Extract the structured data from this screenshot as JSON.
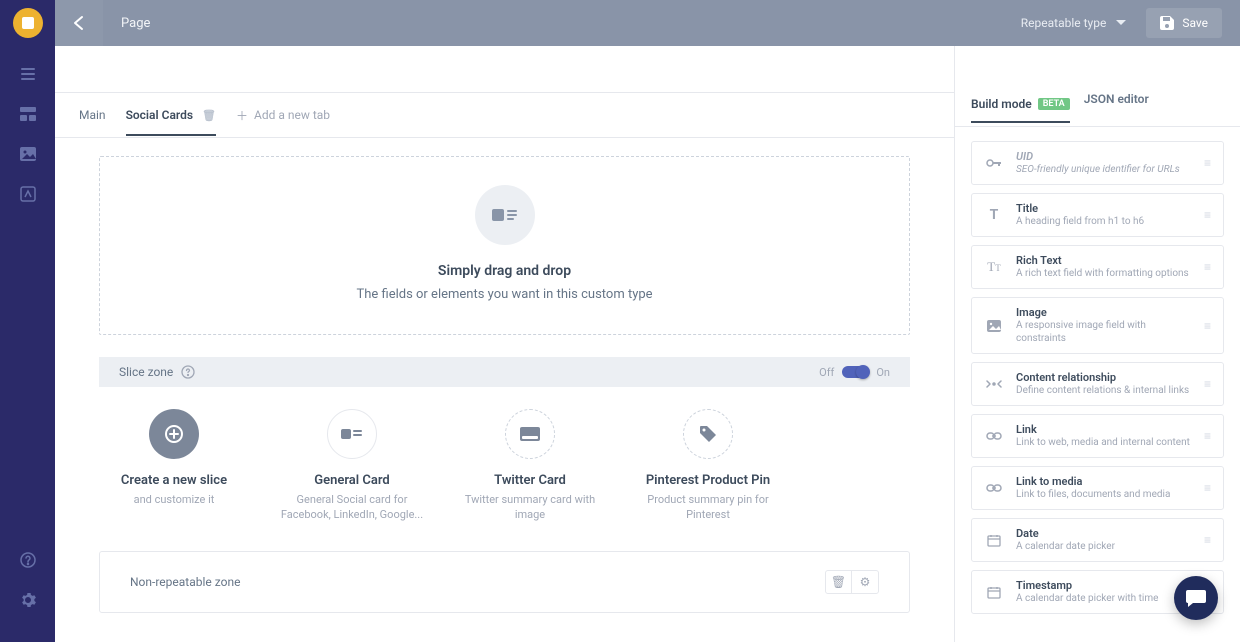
{
  "topbar": {
    "title": "Page",
    "type_select": "Repeatable type",
    "save_label": "Save"
  },
  "tabs": {
    "main": "Main",
    "social": "Social Cards",
    "add": "Add a new tab"
  },
  "drop": {
    "title": "Simply drag and drop",
    "desc": "The fields or elements you want in this custom type"
  },
  "slice_zone": {
    "label": "Slice zone",
    "off": "Off",
    "on": "On"
  },
  "slices": [
    {
      "title": "Create a new slice",
      "desc": "and customize it"
    },
    {
      "title": "General Card",
      "desc": "General Social card for Facebook, LinkedIn, Google..."
    },
    {
      "title": "Twitter Card",
      "desc": "Twitter summary card with image"
    },
    {
      "title": "Pinterest Product Pin",
      "desc": "Product summary pin for Pinterest"
    }
  ],
  "zone": {
    "label": "Non-repeatable zone"
  },
  "panel_tabs": {
    "build": "Build mode",
    "beta": "BETA",
    "json": "JSON editor"
  },
  "fields": [
    {
      "title": "UID",
      "sub": "SEO-friendly unique identifier for URLs",
      "disabled": true
    },
    {
      "title": "Title",
      "sub": "A heading field from h1 to h6"
    },
    {
      "title": "Rich Text",
      "sub": "A rich text field with formatting options"
    },
    {
      "title": "Image",
      "sub": "A responsive image field with constraints"
    },
    {
      "title": "Content relationship",
      "sub": "Define content relations & internal links"
    },
    {
      "title": "Link",
      "sub": "Link to web, media and internal content"
    },
    {
      "title": "Link to media",
      "sub": "Link to files, documents and media"
    },
    {
      "title": "Date",
      "sub": "A calendar date picker"
    },
    {
      "title": "Timestamp",
      "sub": "A calendar date picker with time"
    }
  ]
}
